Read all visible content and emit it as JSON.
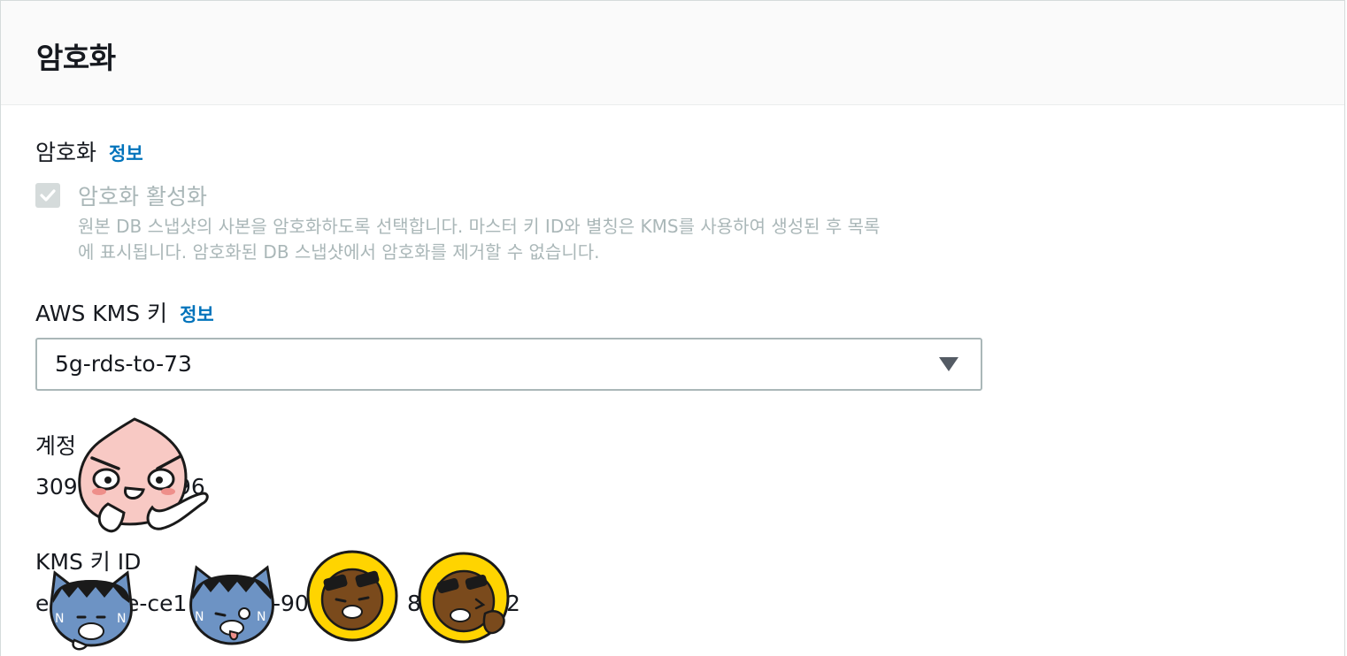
{
  "panel": {
    "title": "암호화"
  },
  "encryption": {
    "label": "암호화",
    "info": "정보",
    "checkbox_label": "암호화 활성화",
    "checkbox_checked": true,
    "description_line1": "원본 DB 스냅샷의 사본을 암호화하도록 선택합니다. 마스터 키 ID와 별칭은 KMS를 사용하여 생성된 후 목록",
    "description_line2": "에 표시됩니다. 암호화된 DB 스냅샷에서 암호화를 제거할 수 없습니다."
  },
  "kms_key": {
    "label": "AWS KMS 키",
    "info": "정보",
    "selected": "5g-rds-to-73",
    "arrow_icon": "caret-down-icon"
  },
  "account": {
    "label": "계정",
    "value": "309",
    "value_tail": "96"
  },
  "kms_key_id": {
    "label": "KMS 키 ID",
    "part1": "e",
    "part2": "e-ce1",
    "part3": "-90",
    "part4": "85",
    "part5": "2"
  },
  "colors": {
    "link": "#0073bb",
    "disabled_text": "#aab7b8",
    "border": "#aab7b8",
    "header_bg": "#fafafa"
  }
}
